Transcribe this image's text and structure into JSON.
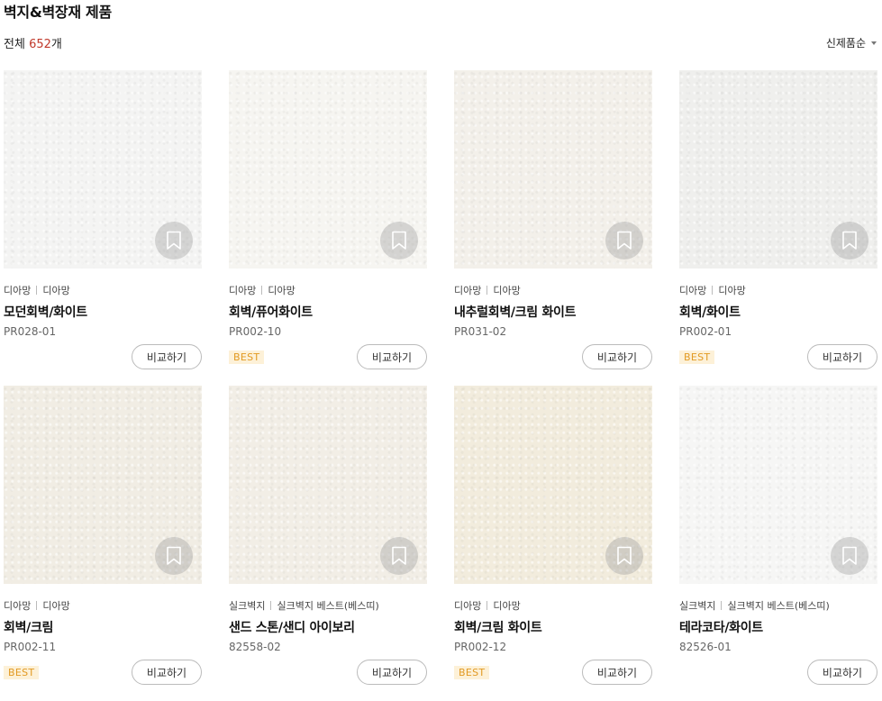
{
  "page": {
    "title": "벽지&벽장재 제품",
    "total_label": "전체",
    "total_count": "652",
    "total_suffix": "개",
    "sort_label": "신제품순"
  },
  "colors": {
    "accent_count": "#c0392b",
    "best_badge_bg": "#fdf1d8",
    "best_badge_text": "#e29a23"
  },
  "compare_label": "비교하기",
  "best_label": "BEST",
  "products": [
    {
      "brand": "디아망",
      "line": "디아망",
      "name": "모던회벽/화이트",
      "code": "PR028-01",
      "best": false,
      "texture": "#f4f4f3"
    },
    {
      "brand": "디아망",
      "line": "디아망",
      "name": "회벽/퓨어화이트",
      "code": "PR002-10",
      "best": true,
      "texture": "#f6f5f1"
    },
    {
      "brand": "디아망",
      "line": "디아망",
      "name": "내추럴회벽/크림 화이트",
      "code": "PR031-02",
      "best": false,
      "texture": "#f3f0ea"
    },
    {
      "brand": "디아망",
      "line": "디아망",
      "name": "회벽/화이트",
      "code": "PR002-01",
      "best": true,
      "texture": "#efefed"
    },
    {
      "brand": "디아망",
      "line": "디아망",
      "name": "회벽/크림",
      "code": "PR002-11",
      "best": true,
      "texture": "#f1ede4"
    },
    {
      "brand": "실크벽지",
      "line": "실크벽지 베스트(베스띠)",
      "name": "샌드 스톤/샌디 아이보리",
      "code": "82558-02",
      "best": false,
      "texture": "#f2eee6"
    },
    {
      "brand": "디아망",
      "line": "디아망",
      "name": "회벽/크림 화이트",
      "code": "PR002-12",
      "best": true,
      "texture": "#f2ecdd"
    },
    {
      "brand": "실크벽지",
      "line": "실크벽지 베스트(베스띠)",
      "name": "테라코타/화이트",
      "code": "82526-01",
      "best": false,
      "texture": "#f6f6f5"
    }
  ]
}
